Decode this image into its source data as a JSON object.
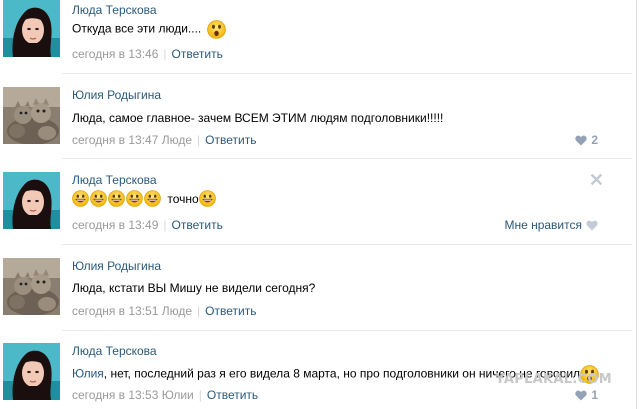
{
  "comments": [
    {
      "author": "Люда Терскова",
      "text": "Откуда все эти люди....",
      "time": "сегодня в 13:46",
      "reply_to": "",
      "reply_label": "Ответить",
      "like_label": "",
      "likes": ""
    },
    {
      "author": "Юлия Родыгина",
      "text": "Люда, самое главное- зачем ВСЕМ ЭТИМ людям подголовники!!!!!",
      "time": "сегодня в 13:47",
      "reply_to": "Люде",
      "reply_label": "Ответить",
      "like_label": "",
      "likes": "2"
    },
    {
      "author": "Люда Терскова",
      "text": "точно",
      "time": "сегодня в 13:49",
      "reply_to": "",
      "reply_label": "Ответить",
      "like_label": "Мне нравится",
      "likes": ""
    },
    {
      "author": "Юлия Родыгина",
      "text": "Люда, кстати ВЫ Мишу не видели сегодня?",
      "time": "сегодня в 13:51",
      "reply_to": "Люде",
      "reply_label": "Ответить",
      "like_label": "",
      "likes": ""
    },
    {
      "author": "Люда Терскова",
      "text_prefix": "Юлия",
      "text": ", нет, последний раз я его видела 8 марта, но про подголовники он ничего не говорил",
      "time": "сегодня в 13:53",
      "reply_to": "Юлии",
      "reply_label": "Ответить",
      "like_label": "",
      "likes": "1"
    }
  ],
  "watermark": "YAPLAKAL.COM",
  "icons": {
    "like": "heart-icon",
    "delete": "close-icon",
    "emoji": "smiley-emoji-icon"
  },
  "colors": {
    "link": "#2b587a",
    "meta": "#999999",
    "divider": "#e7eaed",
    "heart": "#93a3b5"
  }
}
